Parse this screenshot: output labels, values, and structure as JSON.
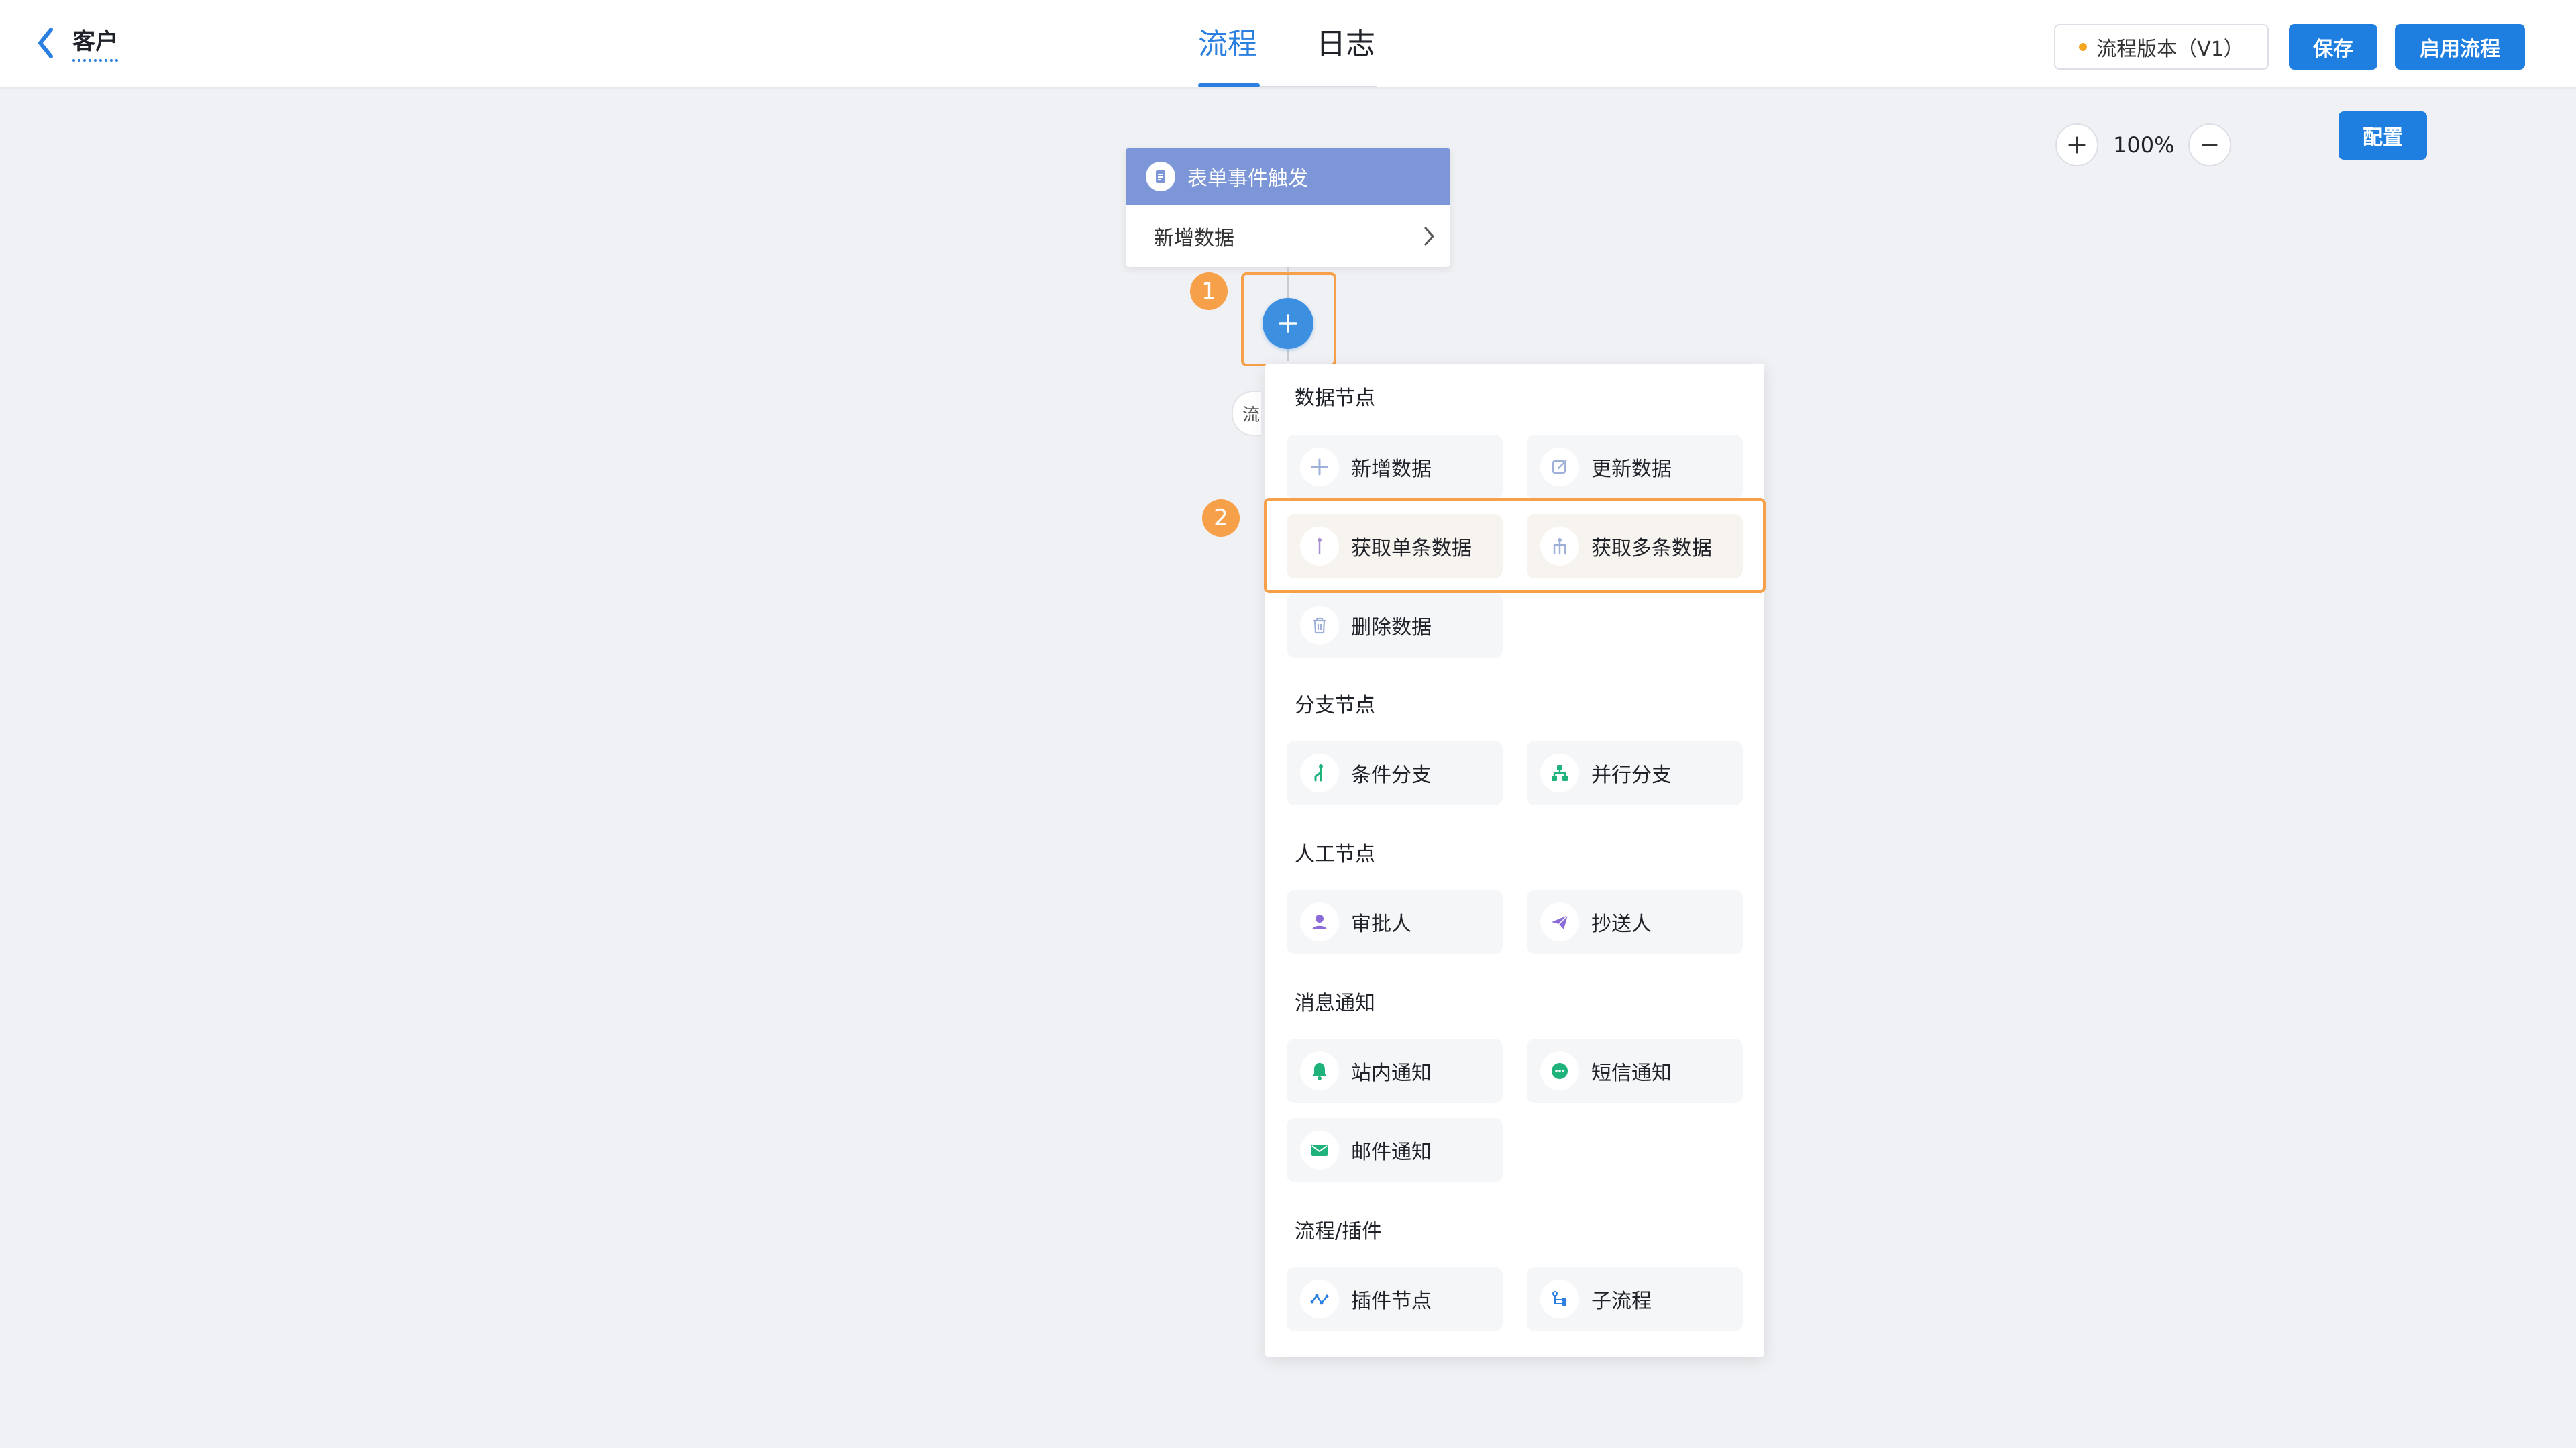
{
  "header": {
    "back_label": "客户",
    "tabs": [
      {
        "label": "流程",
        "active": true
      },
      {
        "label": "日志",
        "active": false
      }
    ],
    "version_label": "流程版本（V1）",
    "save_label": "保存",
    "enable_label": "启用流程"
  },
  "canvas": {
    "zoom": "100%",
    "config_label": "配置",
    "trigger": {
      "title": "表单事件触发",
      "event": "新增数据"
    },
    "badges": [
      "1",
      "2"
    ],
    "hidden_chip_text": "流"
  },
  "panel": {
    "sections": [
      {
        "title": "数据节点",
        "items": [
          "新增数据",
          "更新数据",
          "获取单条数据",
          "获取多条数据",
          "删除数据"
        ]
      },
      {
        "title": "分支节点",
        "items": [
          "条件分支",
          "并行分支"
        ]
      },
      {
        "title": "人工节点",
        "items": [
          "审批人",
          "抄送人"
        ]
      },
      {
        "title": "消息通知",
        "items": [
          "站内通知",
          "短信通知",
          "邮件通知"
        ]
      },
      {
        "title": "流程/插件",
        "items": [
          "插件节点",
          "子流程"
        ]
      }
    ]
  },
  "colors": {
    "primary": "#1e7fe1",
    "highlight": "#f7a04a",
    "trigger_header": "#7c96d8",
    "branch_green": "#1fb27a",
    "person_purple": "#8a6bd8"
  }
}
